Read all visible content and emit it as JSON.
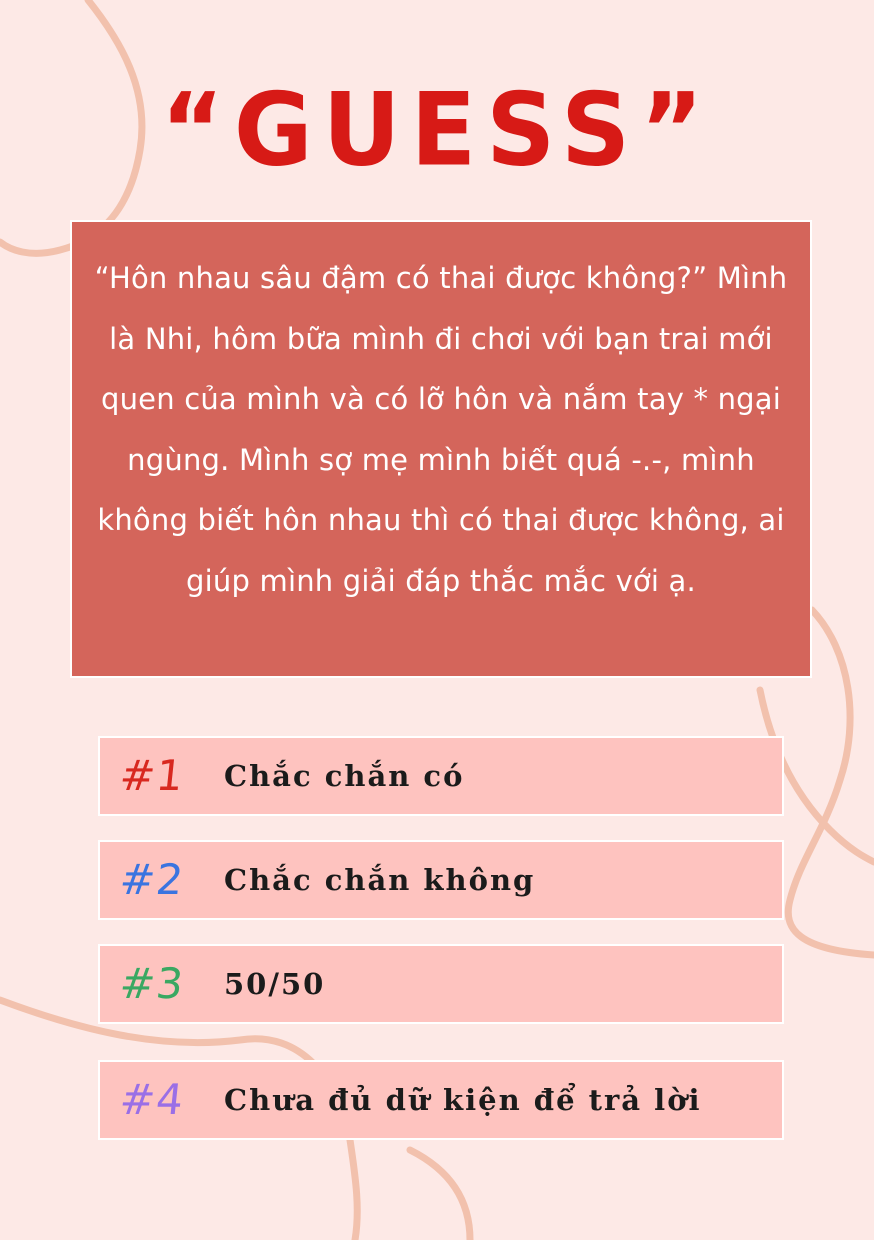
{
  "page": {
    "title": "“GUESS”"
  },
  "story": {
    "text": "“Hôn nhau sâu đậm có thai được không?” Mình là Nhi, hôm bữa mình đi chơi với bạn trai mới quen của mình và có lỡ hôn và nắm tay * ngại ngùng. Mình sợ mẹ mình biết quá -.-, mình không biết hôn nhau thì có thai được không, ai giúp mình giải đáp thắc mắc với ạ."
  },
  "options": [
    {
      "number": "#1",
      "label": "Chắc chắn có",
      "color": "#d8281f"
    },
    {
      "number": "#2",
      "label": "Chắc chắn không",
      "color": "#3a74e0"
    },
    {
      "number": "#3",
      "label": "50/50",
      "color": "#3aa862"
    },
    {
      "number": "#4",
      "label": "Chưa đủ dữ kiện để trả lời",
      "color": "#9a6fe6"
    }
  ],
  "colors": {
    "background": "#fde9e6",
    "title": "#d71a16",
    "story_box": "#d4655b",
    "option_box": "#fec3bf",
    "decor_line": "#f2c1ad"
  }
}
